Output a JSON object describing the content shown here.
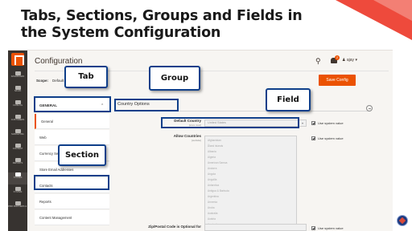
{
  "slide": {
    "title": "Tabs, Sections, Groups and Fields in the System Configuration"
  },
  "colors": {
    "accent": "#eb5202",
    "callout_border": "#0f3f8a",
    "sidebar_bg": "#373330"
  },
  "admin": {
    "page_title": "Configuration",
    "header": {
      "search_icon": "search-icon",
      "notification_count": "2",
      "user_name": "ajay"
    },
    "scope": {
      "label": "Scope:",
      "value": "Default"
    },
    "save_button": "Save Config",
    "sidebar": {
      "items": [
        {
          "label": "DASHBOARD",
          "icon": "dashboard-icon"
        },
        {
          "label": "SALES",
          "icon": "dollar-icon"
        },
        {
          "label": "CATALOG",
          "icon": "cube-icon"
        },
        {
          "label": "CUSTOMERS",
          "icon": "person-icon"
        },
        {
          "label": "MARKETING",
          "icon": "megaphone-icon"
        },
        {
          "label": "CONTENT",
          "icon": "layout-icon"
        },
        {
          "label": "REPORTS",
          "icon": "bar-chart-icon"
        },
        {
          "label": "STORES",
          "icon": "store-icon"
        },
        {
          "label": "SYSTEM",
          "icon": "gear-icon"
        },
        {
          "label": "FIND PARTNERS & EXTENSIONS",
          "icon": "puzzle-icon"
        }
      ]
    },
    "tab": {
      "label": "GENERAL"
    },
    "sections": [
      {
        "label": "General",
        "active": true
      },
      {
        "label": "Web",
        "active": false
      },
      {
        "label": "Currency Setup",
        "active": false
      },
      {
        "label": "Store Email Addresses",
        "active": false
      },
      {
        "label": "Contacts",
        "active": false
      },
      {
        "label": "Reports",
        "active": false
      },
      {
        "label": "Content Management",
        "active": false
      }
    ],
    "group": {
      "title": "Country Options"
    },
    "fields": {
      "default_country": {
        "label": "Default Country",
        "scope": "[store view]",
        "value": "United States",
        "use_system_value": "Use system value"
      },
      "allow_countries": {
        "label": "Allow Countries",
        "scope": "[website]",
        "options": [
          "Afghanistan",
          "Åland Islands",
          "Albania",
          "Algeria",
          "American Samoa",
          "Andorra",
          "Angola",
          "Anguilla",
          "Antarctica",
          "Antigua & Barbuda",
          "Argentina",
          "Armenia",
          "Aruba",
          "Australia",
          "Austria",
          "Azerbaijan"
        ],
        "use_system_value": "Use system value"
      },
      "zip_optional": {
        "label": "Zip/Postal Code is Optional for",
        "use_system_value": "Use system value"
      }
    }
  },
  "callouts": {
    "tab": "Tab",
    "group": "Group",
    "field": "Field",
    "section": "Section"
  }
}
